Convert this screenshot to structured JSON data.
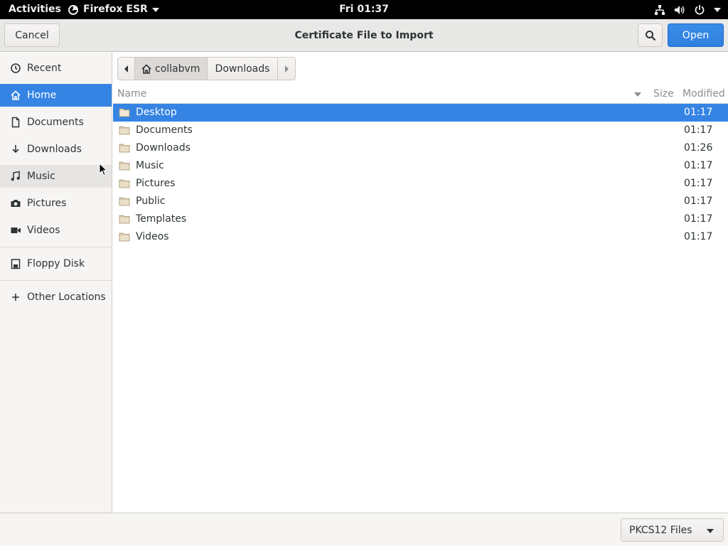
{
  "topbar": {
    "activities": "Activities",
    "app_name": "Firefox ESR",
    "clock": "Fri 01:37"
  },
  "dialog": {
    "title": "Certificate File to Import",
    "cancel_label": "Cancel",
    "open_label": "Open"
  },
  "sidebar": {
    "items": [
      {
        "label": "Recent",
        "icon": "clock-icon"
      },
      {
        "label": "Home",
        "icon": "home-icon"
      },
      {
        "label": "Documents",
        "icon": "document-icon"
      },
      {
        "label": "Downloads",
        "icon": "download-icon"
      },
      {
        "label": "Music",
        "icon": "music-icon"
      },
      {
        "label": "Pictures",
        "icon": "camera-icon"
      },
      {
        "label": "Videos",
        "icon": "video-icon"
      },
      {
        "label": "Floppy Disk",
        "icon": "floppy-icon"
      },
      {
        "label": "Other Locations",
        "icon": "plus-icon"
      }
    ],
    "selected": "Home"
  },
  "pathbar": {
    "home": "collabvm",
    "current": "Downloads"
  },
  "columns": {
    "name": "Name",
    "size": "Size",
    "modified": "Modified"
  },
  "files": [
    {
      "name": "Desktop",
      "modified": "01:17",
      "selected": true
    },
    {
      "name": "Documents",
      "modified": "01:17"
    },
    {
      "name": "Downloads",
      "modified": "01:26"
    },
    {
      "name": "Music",
      "modified": "01:17"
    },
    {
      "name": "Pictures",
      "modified": "01:17"
    },
    {
      "name": "Public",
      "modified": "01:17"
    },
    {
      "name": "Templates",
      "modified": "01:17"
    },
    {
      "name": "Videos",
      "modified": "01:17"
    }
  ],
  "filter": {
    "selected": "PKCS12 Files"
  },
  "colors": {
    "accent": "#3584e4",
    "topbar": "#000000",
    "sidebar_bg": "#f6f5f4"
  }
}
